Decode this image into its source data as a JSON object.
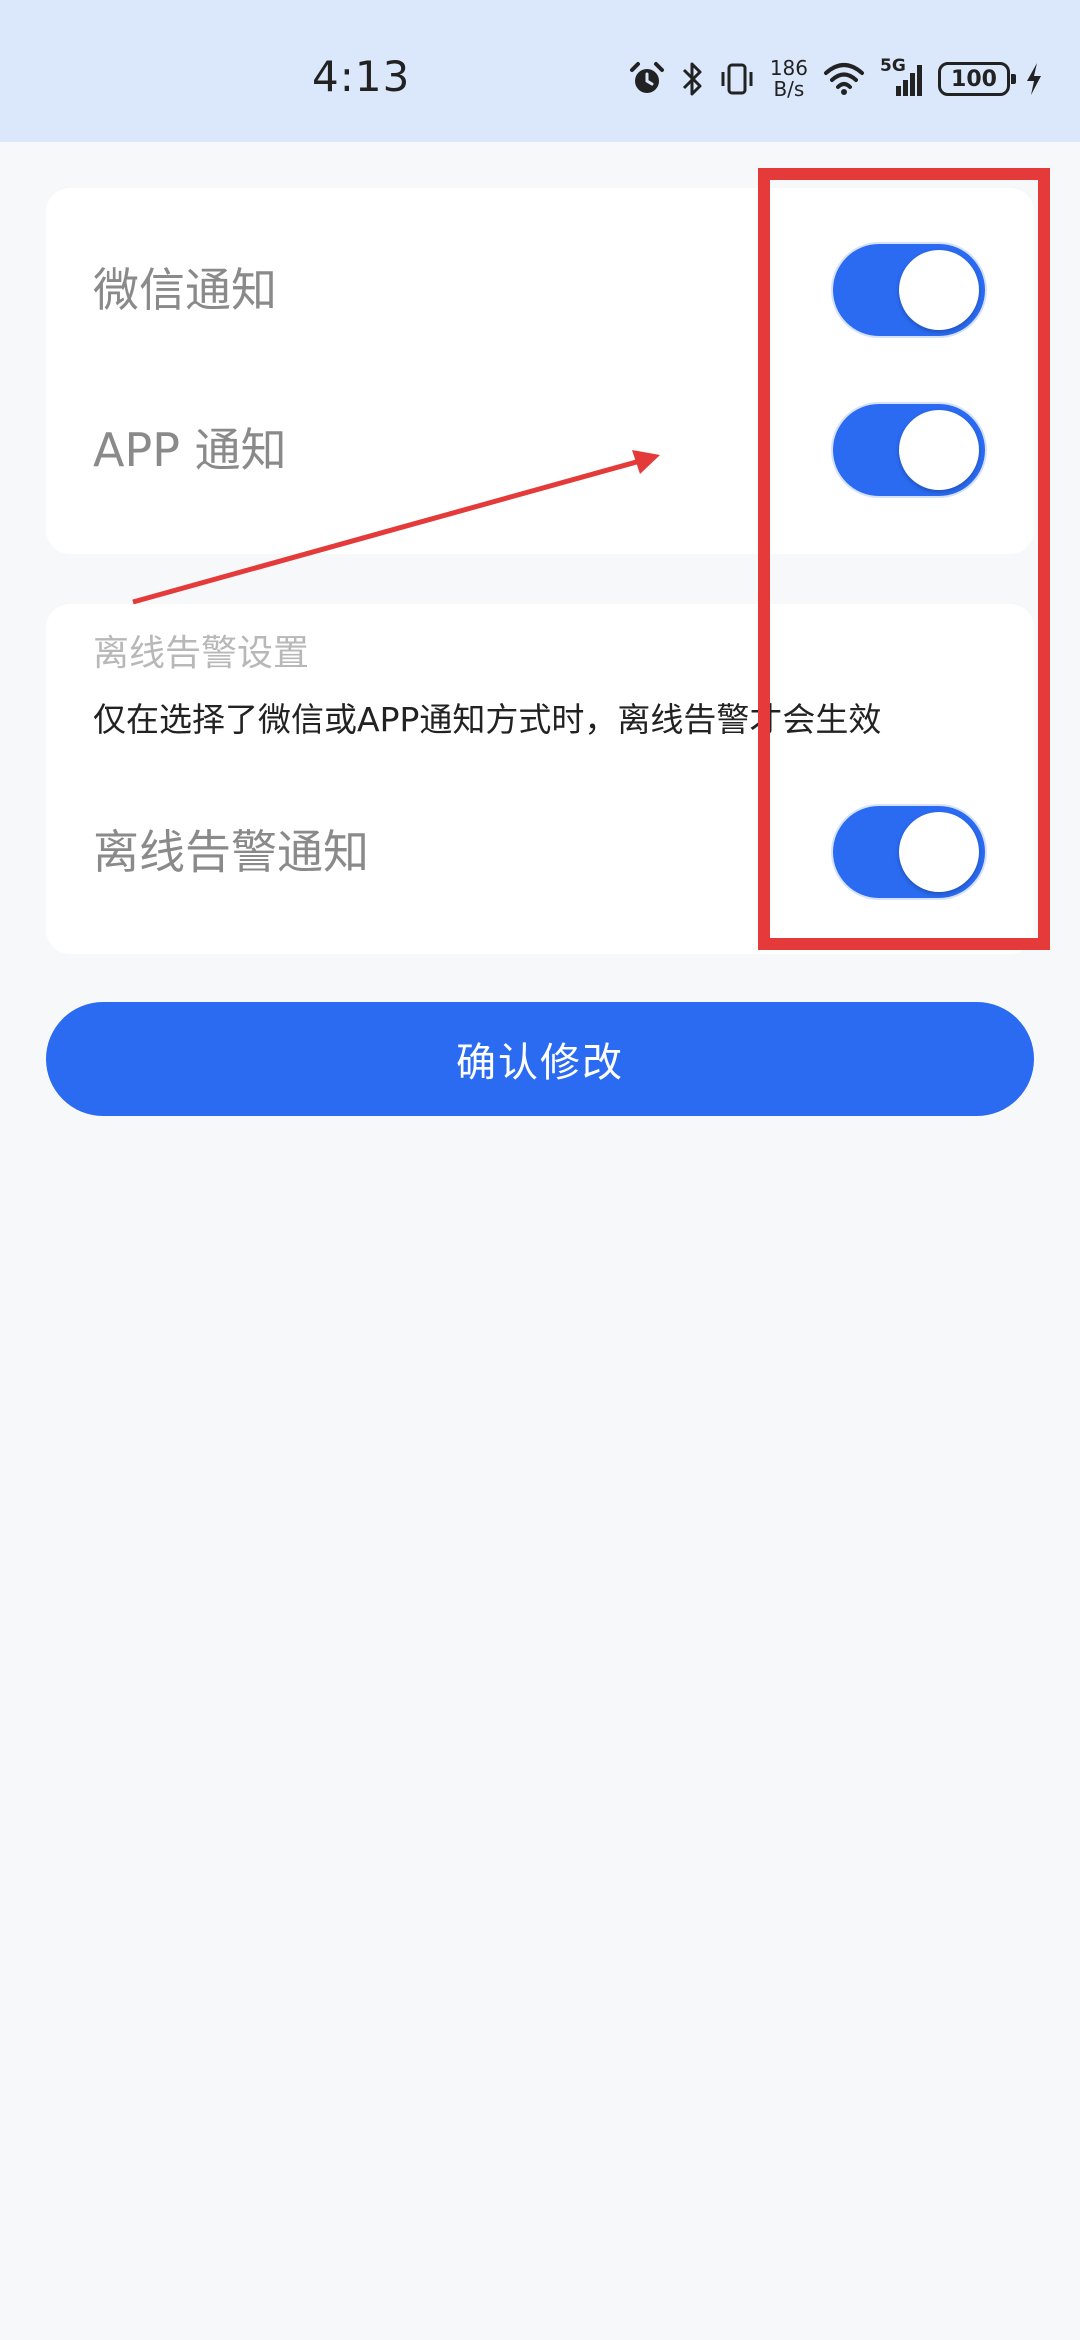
{
  "status_bar": {
    "time": "4:13",
    "net_speed_value": "186",
    "net_speed_unit": "B/s",
    "network_type": "5G",
    "battery": "100",
    "icons": [
      "alarm-icon",
      "bluetooth-icon",
      "vibrate-icon",
      "wifi-icon",
      "signal-icon",
      "battery-icon",
      "charging-icon"
    ]
  },
  "notify_card": {
    "items": [
      {
        "label": "微信通知",
        "enabled": true
      },
      {
        "label": "APP 通知",
        "enabled": true
      }
    ]
  },
  "offline_card": {
    "title": "离线告警设置",
    "hint": "仅在选择了微信或APP通知方式时，离线告警才会生效",
    "item": {
      "label": "离线告警通知",
      "enabled": true
    }
  },
  "confirm_button": {
    "label": "确认修改"
  },
  "colors": {
    "accent": "#2a6bf2",
    "status_bar_bg": "#dbe8fb",
    "page_bg": "#f7f8fa",
    "annotation": "#e53a3a"
  }
}
